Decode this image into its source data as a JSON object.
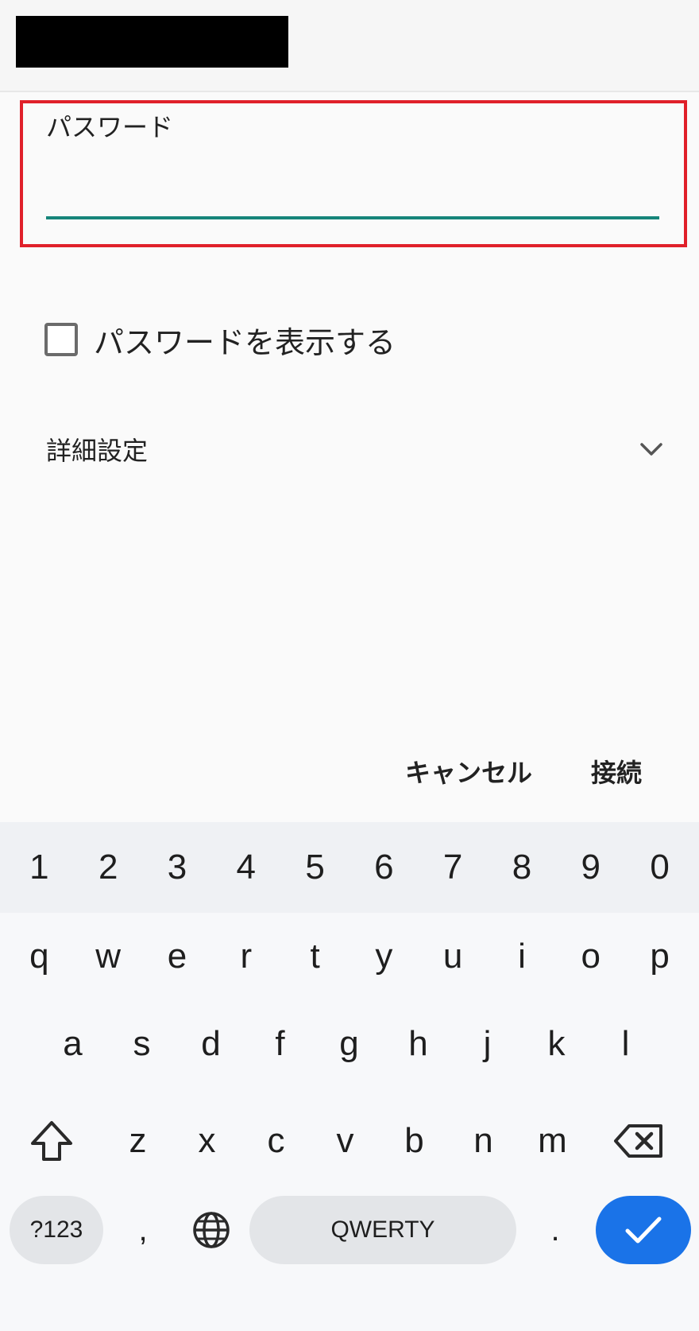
{
  "password_field": {
    "label": "パスワード",
    "value": ""
  },
  "show_password": {
    "label": "パスワードを表示する",
    "checked": false
  },
  "advanced": {
    "label": "詳細設定",
    "icon": "chevron-down-icon"
  },
  "actions": {
    "cancel_label": "キャンセル",
    "connect_label": "接続"
  },
  "keyboard": {
    "numbers": [
      "1",
      "2",
      "3",
      "4",
      "5",
      "6",
      "7",
      "8",
      "9",
      "0"
    ],
    "row1": [
      "q",
      "w",
      "e",
      "r",
      "t",
      "y",
      "u",
      "i",
      "o",
      "p"
    ],
    "row2": [
      "a",
      "s",
      "d",
      "f",
      "g",
      "h",
      "j",
      "k",
      "l"
    ],
    "row3": [
      "z",
      "x",
      "c",
      "v",
      "b",
      "n",
      "m"
    ],
    "symbols_label": "?123",
    "comma": ",",
    "space_label": "QWERTY",
    "period": ".",
    "shift_icon": "shift-icon",
    "backspace_icon": "backspace-icon",
    "globe_icon": "globe-icon",
    "enter_icon": "checkmark-icon"
  },
  "colors": {
    "highlight_border": "#e0202a",
    "field_underline": "#16857a",
    "enter_key": "#1a73e8"
  }
}
